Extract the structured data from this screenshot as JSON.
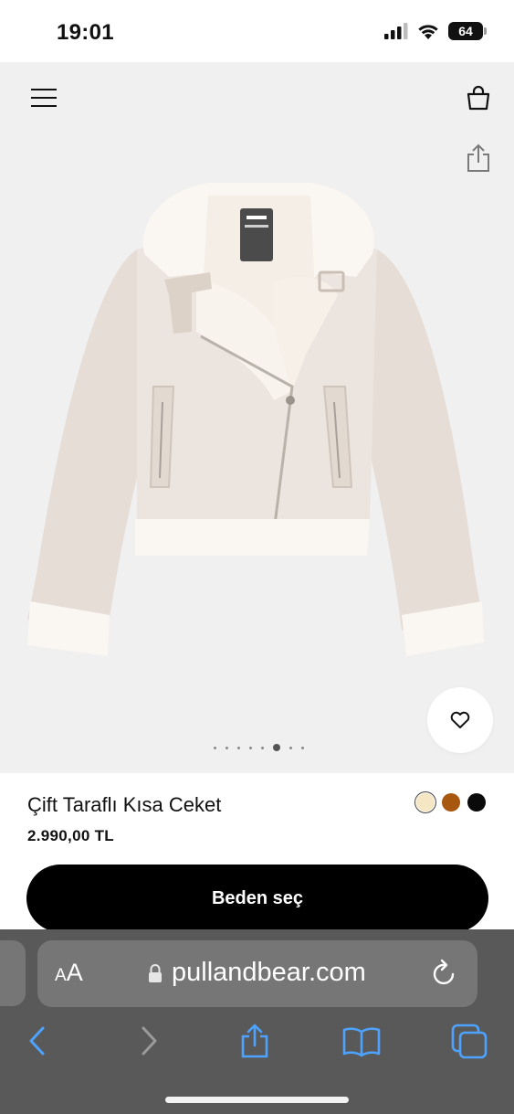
{
  "status_bar": {
    "time": "19:01",
    "battery": "64"
  },
  "header": {
    "menu_icon": "hamburger-menu-icon",
    "bag_icon": "shopping-bag-icon",
    "share_icon": "share-icon"
  },
  "gallery": {
    "image_count": 8,
    "active_index": 5,
    "favorite_icon": "heart-icon"
  },
  "product": {
    "name": "Çift Taraflı Kısa Ceket",
    "price": "2.990,00 TL",
    "colors": [
      {
        "name": "cream",
        "hex": "#f5e6c4",
        "selected": true
      },
      {
        "name": "brown",
        "hex": "#a8570f",
        "selected": false
      },
      {
        "name": "black",
        "hex": "#0a0a0a",
        "selected": false
      }
    ]
  },
  "cta": {
    "label": "Beden seç"
  },
  "browser": {
    "text_size_label_small": "A",
    "text_size_label_large": "A",
    "url": "pullandbear.com",
    "toolbar_icons": [
      "back-icon",
      "forward-icon",
      "share-icon",
      "bookmarks-icon",
      "tabs-icon"
    ]
  }
}
